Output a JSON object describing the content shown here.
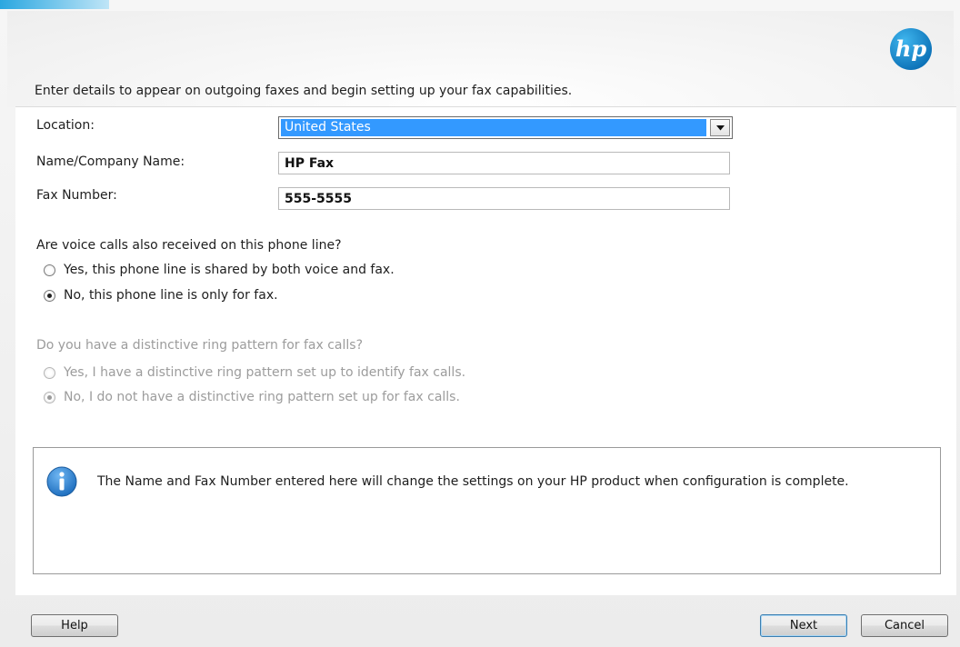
{
  "header": {
    "instruction": "Enter details to appear on outgoing faxes and begin setting up your fax capabilities.",
    "logo_text": "hp"
  },
  "form": {
    "location_label": "Location:",
    "location_value": "United States",
    "name_label": "Name/Company Name:",
    "name_value": "HP Fax",
    "fax_label": "Fax Number:",
    "fax_value": "555-5555"
  },
  "voice_question": {
    "text": "Are voice calls also received on this phone line?",
    "options": [
      {
        "label": "Yes, this phone line is shared by both voice and fax.",
        "checked": false
      },
      {
        "label": "No, this phone line is only for fax.",
        "checked": true
      }
    ]
  },
  "ring_question": {
    "text": "Do you have a distinctive ring pattern for fax calls?",
    "enabled": false,
    "options": [
      {
        "label": "Yes, I have a distinctive ring pattern set up to identify fax calls.",
        "checked": false
      },
      {
        "label": "No, I do not have a distinctive ring pattern set up for fax calls.",
        "checked": true
      }
    ]
  },
  "info": {
    "message": "The Name and Fax Number entered here will change the settings on your HP product when configuration is complete."
  },
  "buttons": {
    "help": "Help",
    "next": "Next",
    "cancel": "Cancel"
  },
  "colors": {
    "selection": "#3399ff",
    "hp_blue": "#0096d6",
    "info_blue": "#1f6fbf"
  }
}
